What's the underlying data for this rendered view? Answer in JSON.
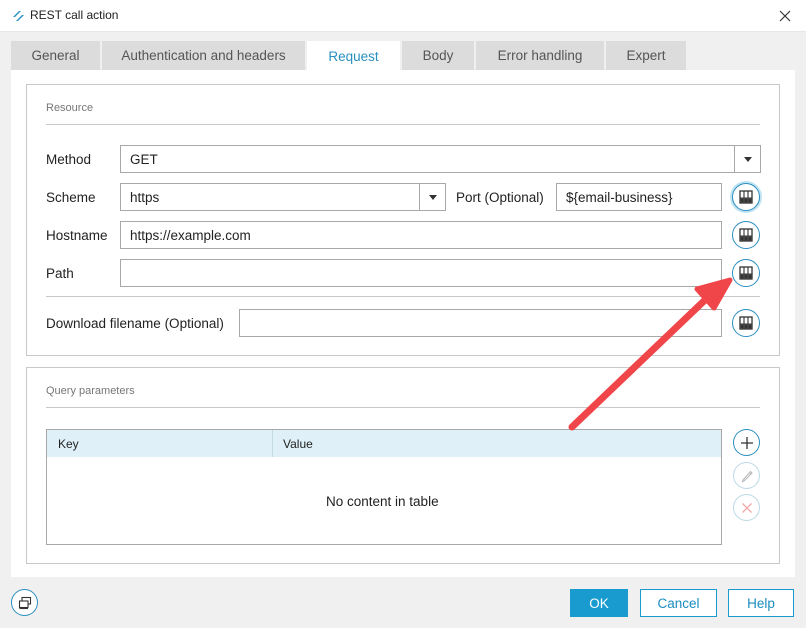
{
  "window": {
    "title": "REST call action"
  },
  "tabs": [
    {
      "label": "General",
      "active": false
    },
    {
      "label": "Authentication and headers",
      "active": false
    },
    {
      "label": "Request",
      "active": true
    },
    {
      "label": "Body",
      "active": false
    },
    {
      "label": "Error handling",
      "active": false
    },
    {
      "label": "Expert",
      "active": false
    }
  ],
  "resource": {
    "title": "Resource",
    "method": {
      "label": "Method",
      "value": "GET"
    },
    "scheme": {
      "label": "Scheme",
      "value": "https"
    },
    "port": {
      "label": "Port (Optional)",
      "value": "${email-business}"
    },
    "hostname": {
      "label": "Hostname",
      "value": "https://example.com"
    },
    "path": {
      "label": "Path",
      "value": ""
    },
    "download_filename": {
      "label": "Download filename (Optional)",
      "value": ""
    }
  },
  "query_parameters": {
    "title": "Query parameters",
    "columns": [
      "Key",
      "Value"
    ],
    "rows": [],
    "empty_text": "No content in table"
  },
  "footer": {
    "ok_label": "OK",
    "cancel_label": "Cancel",
    "help_label": "Help"
  },
  "colors": {
    "accent": "#1a9bd0",
    "annotation_arrow": "#f0464a",
    "table_header": "#dff0f9"
  },
  "icons": {
    "app": "app-logo-icon",
    "close": "close-icon",
    "variable": "variable-picker-icon",
    "add": "plus-icon",
    "edit": "pencil-icon",
    "delete": "x-icon",
    "footer": "window-icon"
  }
}
